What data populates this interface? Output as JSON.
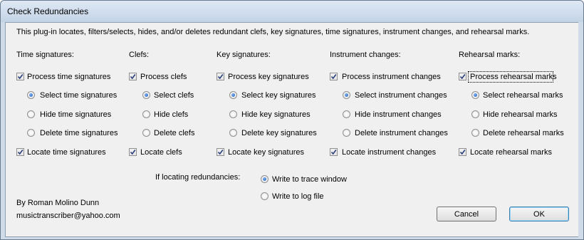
{
  "window": {
    "title": "Check Redundancies"
  },
  "description": "This plug-in locates, filters/selects, hides, and/or deletes redundant clefs, key signatures, time signatures, instrument changes, and rehearsal marks.",
  "columns": [
    {
      "header": "Time signatures:",
      "process": "Process time signatures",
      "select": "Select time signatures",
      "hide": "Hide time signatures",
      "delete": "Delete time signatures",
      "locate": "Locate time signatures"
    },
    {
      "header": "Clefs:",
      "process": "Process clefs",
      "select": "Select clefs",
      "hide": "Hide clefs",
      "delete": "Delete clefs",
      "locate": "Locate clefs"
    },
    {
      "header": "Key signatures:",
      "process": "Process key signatures",
      "select": "Select key signatures",
      "hide": "Hide key signatures",
      "delete": "Delete key signatures",
      "locate": "Locate key signatures"
    },
    {
      "header": "Instrument changes:",
      "process": "Process instrument changes",
      "select": "Select instrument changes",
      "hide": "Hide instrument changes",
      "delete": "Delete instrument changes",
      "locate": "Locate instrument changes"
    },
    {
      "header": "Rehearsal marks:",
      "process": "Process rehearsal marks",
      "select": "Select rehearsal marks",
      "hide": "Hide rehearsal marks",
      "delete": "Delete rehearsal marks",
      "locate": "Locate rehearsal marks"
    }
  ],
  "locating": {
    "label": "If locating redundancies:",
    "trace": "Write to trace window",
    "log": "Write to log file"
  },
  "author": {
    "name": "By Roman Molino Dunn",
    "email": "musictranscriber@yahoo.com"
  },
  "buttons": {
    "cancel": "Cancel",
    "ok": "OK"
  }
}
